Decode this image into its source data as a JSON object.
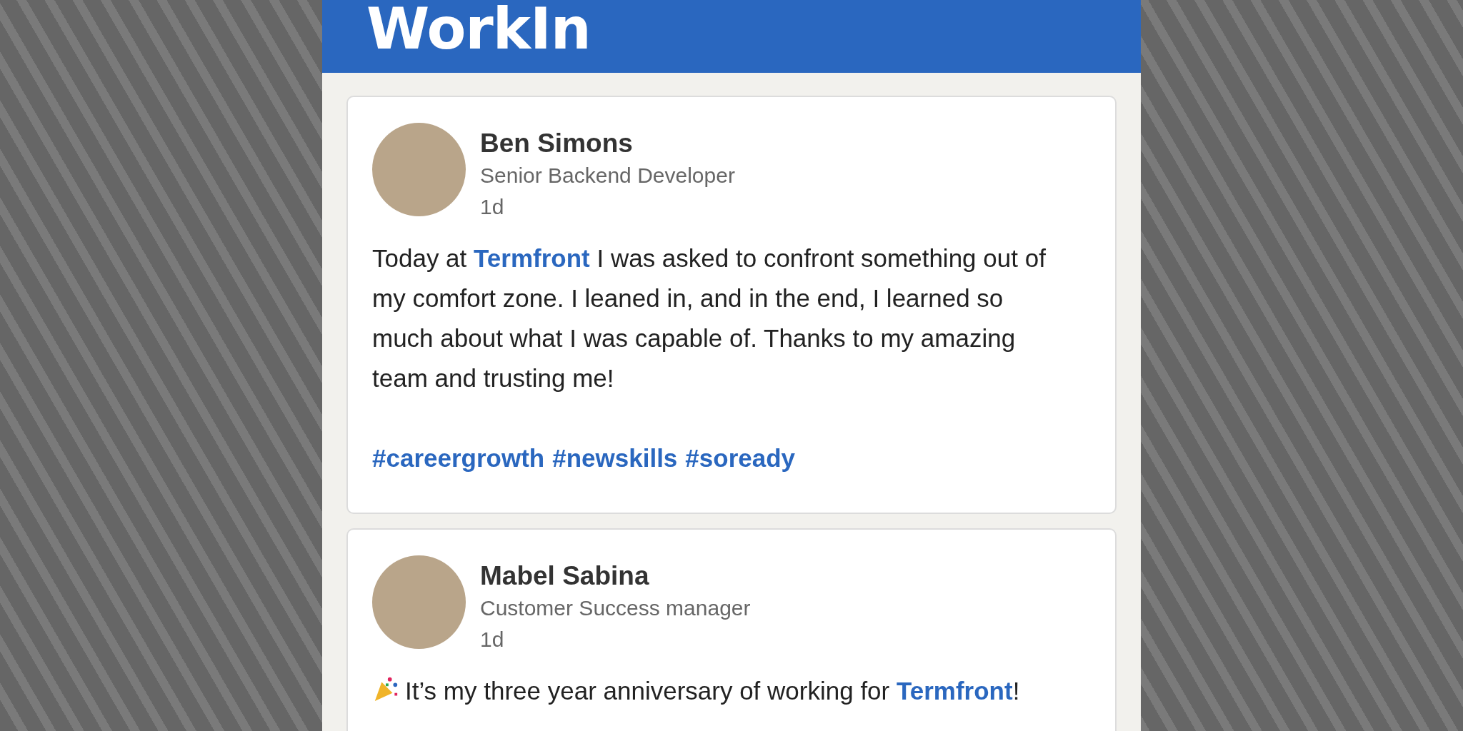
{
  "header": {
    "logo": "WorkIn"
  },
  "posts": [
    {
      "author": "Ben Simons",
      "role": "Senior Backend Developer",
      "time": "1d",
      "emoji": false,
      "body": [
        {
          "kind": "text",
          "text": "Today at "
        },
        {
          "kind": "link",
          "text": "Termfront"
        },
        {
          "kind": "text",
          "text": " I was asked to confront something out of my comfort zone. I leaned in, and in the end, I learned so much about what I was capable of. Thanks to my amazing team and trusting me!"
        }
      ],
      "hashtags": [
        "#careergrowth",
        "#newskills",
        "#soready"
      ]
    },
    {
      "author": "Mabel Sabina",
      "role": "Customer Success manager",
      "time": "1d",
      "emoji": true,
      "body": [
        {
          "kind": "text",
          "text": "It’s my three year anniversary of working for "
        },
        {
          "kind": "link",
          "text": "Termfront"
        },
        {
          "kind": "text",
          "text": "!"
        }
      ]
    }
  ]
}
